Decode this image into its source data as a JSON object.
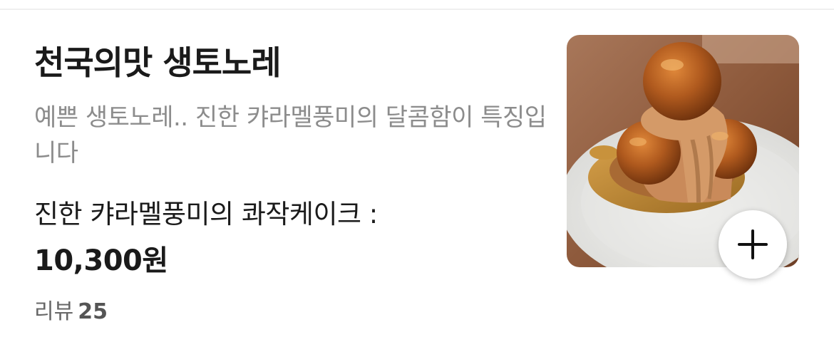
{
  "menu_item": {
    "title": "천국의맛 생토노레",
    "description": "예쁜 생토노레.. 진한 캬라멜풍미의 달콤함이 특징입니다",
    "option_text": "진한 캬라멜풍미의 콰작케이크 :",
    "price": "10,300원",
    "review_label": "리뷰",
    "review_count": "25",
    "photo_icon": "saint-honore-cake-photo",
    "add_icon": "plus-icon"
  },
  "colors": {
    "title": "#1a1a1a",
    "description": "#8c8c8c",
    "review_label": "#666666"
  }
}
